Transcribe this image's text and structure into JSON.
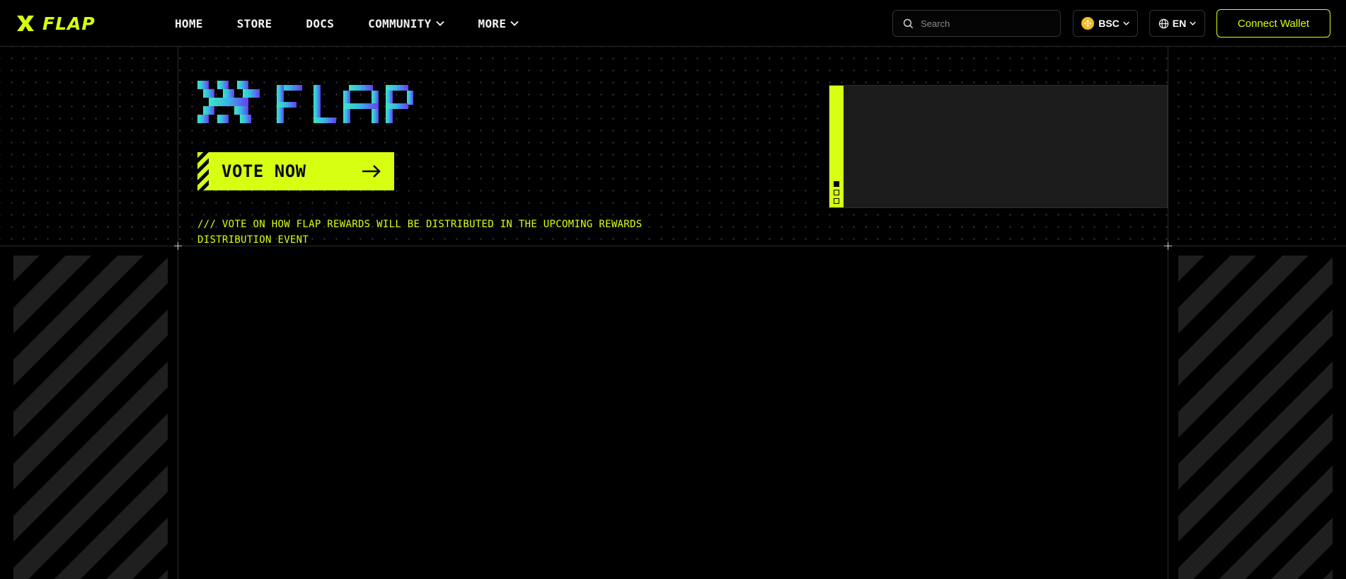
{
  "nav": {
    "brand": "FLAP",
    "items": [
      {
        "label": "HOME",
        "has_dropdown": false
      },
      {
        "label": "STORE",
        "has_dropdown": false
      },
      {
        "label": "DOCS",
        "has_dropdown": false
      },
      {
        "label": "COMMUNITY",
        "has_dropdown": true
      },
      {
        "label": "MORE",
        "has_dropdown": true
      }
    ],
    "search_placeholder": "Search",
    "chain": "BSC",
    "language": "EN",
    "connect_label": "Connect Wallet"
  },
  "hero": {
    "logo_text": "FLAP",
    "vote_label": "VOTE NOW",
    "description": "/// VOTE ON HOW FLAP REWARDS WILL BE DISTRIBUTED IN THE UPCOMING REWARDS DISTRIBUTION EVENT",
    "carousel_slides": 3,
    "carousel_active_index": 0
  },
  "icons": {
    "brand": "flap-x-icon",
    "search": "search-icon",
    "chevron": "chevron-down-icon",
    "globe": "globe-icon",
    "arrow": "arrow-right-icon",
    "chain": "bnb-coin-icon"
  },
  "colors": {
    "accent": "#d7ff12",
    "background": "#000000",
    "gradient_start": "#3fe6c0",
    "gradient_end": "#6a3cf0",
    "bnb": "#f3ba2f"
  }
}
